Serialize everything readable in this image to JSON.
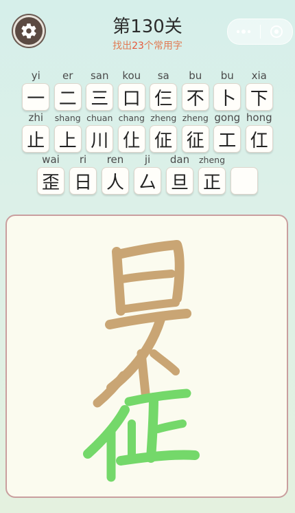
{
  "header": {
    "level_title": "第130关",
    "subtitle_prefix": "找出",
    "subtitle_count": "23",
    "subtitle_suffix": "个常用字"
  },
  "found_characters": [
    [
      {
        "pinyin": "yi",
        "char": "一"
      },
      {
        "pinyin": "er",
        "char": "二"
      },
      {
        "pinyin": "san",
        "char": "三"
      },
      {
        "pinyin": "kou",
        "char": "口"
      },
      {
        "pinyin": "sa",
        "char": "仨"
      },
      {
        "pinyin": "bu",
        "char": "不"
      },
      {
        "pinyin": "bu",
        "char": "卜"
      },
      {
        "pinyin": "xia",
        "char": "下"
      }
    ],
    [
      {
        "pinyin": "zhi",
        "char": "止"
      },
      {
        "pinyin": "shang",
        "char": "上"
      },
      {
        "pinyin": "chuan",
        "char": "川"
      },
      {
        "pinyin": "chang",
        "char": "仩"
      },
      {
        "pinyin": "zheng",
        "char": "佂"
      },
      {
        "pinyin": "zheng",
        "char": "征"
      },
      {
        "pinyin": "gong",
        "char": "工"
      },
      {
        "pinyin": "hong",
        "char": "仜"
      }
    ],
    [
      {
        "pinyin": "wai",
        "char": "歪"
      },
      {
        "pinyin": "ri",
        "char": "日"
      },
      {
        "pinyin": "ren",
        "char": "人"
      },
      {
        "pinyin": "ji",
        "char": "厶"
      },
      {
        "pinyin": "dan",
        "char": "旦"
      },
      {
        "pinyin": "zheng",
        "char": "正"
      },
      {
        "pinyin": "",
        "char": ""
      }
    ]
  ],
  "board": {
    "puzzle_char_main_color": "#c9a574",
    "puzzle_char_highlight_color": "#74d86a",
    "highlighted_part": "征"
  },
  "colors": {
    "accent": "#e07b54",
    "board_border": "#c99e9e"
  }
}
